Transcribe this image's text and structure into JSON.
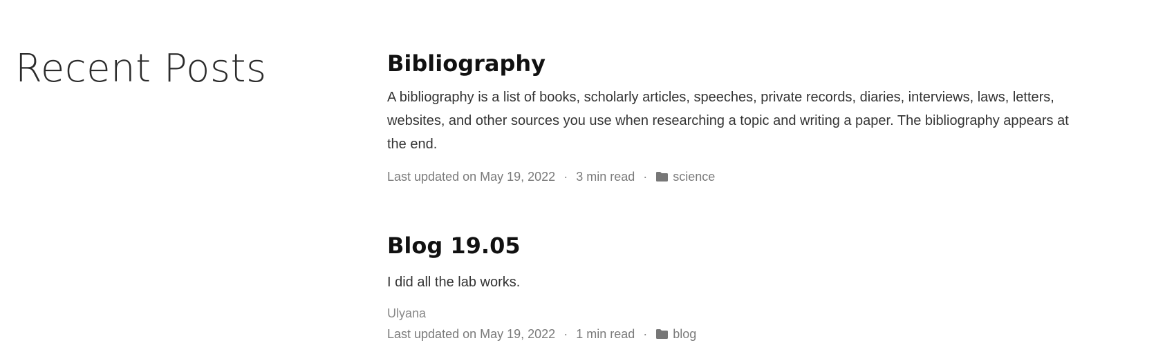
{
  "section": {
    "title": "Recent Posts"
  },
  "posts": [
    {
      "title": "Bibliography",
      "summary": "A bibliography is a list of books, scholarly articles, speeches, private records, diaries, interviews, laws, letters, websites, and other sources you use when researching a topic and writing a paper. The bibliography appears at the end.",
      "updated": "Last updated on May 19, 2022",
      "read_time": "3 min read",
      "category": "science",
      "category_icon": "folder-icon"
    },
    {
      "title": "Blog 19.05",
      "summary": "I did all the lab works.",
      "author": "Ulyana",
      "updated": "Last updated on May 19, 2022",
      "read_time": "1 min read",
      "category": "blog",
      "category_icon": "folder-icon"
    }
  ],
  "meta_separator": "·",
  "colors": {
    "text": "#222222",
    "muted": "#7a7a7a",
    "title": "#111111"
  }
}
